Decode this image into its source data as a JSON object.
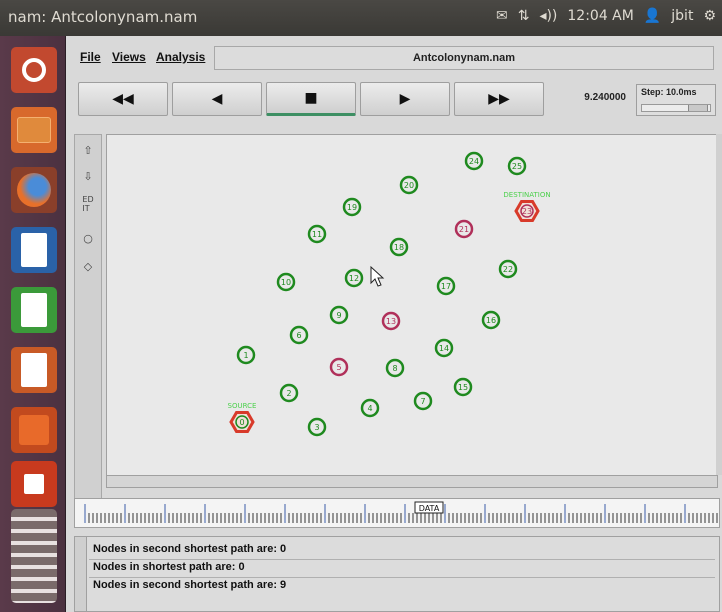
{
  "window": {
    "title": "nam: Antcolonynam.nam"
  },
  "tray": {
    "mail_icon": "mail-icon",
    "network_icon": "network-icon",
    "volume": "◂))",
    "time": "12:04 AM",
    "user": "jbit",
    "settings_icon": "gear-icon"
  },
  "menu": {
    "file": "File",
    "views": "Views",
    "analysis": "Analysis",
    "doc_title": "Antcolonynam.nam"
  },
  "controls": {
    "rewind": "◀◀",
    "back": "◀",
    "stop": "■",
    "play": "▶",
    "forward": "▶▶",
    "time": "9.240000",
    "step": "Step: 10.0ms"
  },
  "network": {
    "nodes": [
      {
        "id": "0",
        "kind": "source"
      },
      {
        "id": "1",
        "kind": "normal"
      },
      {
        "id": "2",
        "kind": "normal"
      },
      {
        "id": "3",
        "kind": "normal"
      },
      {
        "id": "4",
        "kind": "normal"
      },
      {
        "id": "5",
        "kind": "pink"
      },
      {
        "id": "6",
        "kind": "normal"
      },
      {
        "id": "7",
        "kind": "normal"
      },
      {
        "id": "8",
        "kind": "normal"
      },
      {
        "id": "9",
        "kind": "normal"
      },
      {
        "id": "10",
        "kind": "normal"
      },
      {
        "id": "11",
        "kind": "normal"
      },
      {
        "id": "12",
        "kind": "normal"
      },
      {
        "id": "13",
        "kind": "pink"
      },
      {
        "id": "14",
        "kind": "normal"
      },
      {
        "id": "15",
        "kind": "normal"
      },
      {
        "id": "16",
        "kind": "normal"
      },
      {
        "id": "17",
        "kind": "normal"
      },
      {
        "id": "18",
        "kind": "normal"
      },
      {
        "id": "19",
        "kind": "normal"
      },
      {
        "id": "20",
        "kind": "normal"
      },
      {
        "id": "21",
        "kind": "pink"
      },
      {
        "id": "22",
        "kind": "normal"
      },
      {
        "id": "23",
        "kind": "destination"
      },
      {
        "id": "24",
        "kind": "normal"
      },
      {
        "id": "25",
        "kind": "normal"
      }
    ],
    "source_label": "SOURCE",
    "destination_label": "DESTINATION",
    "colors": {
      "normal": "#1f8a1f",
      "pink": "#b0305a",
      "hex": "#d83a2a",
      "label": "#4dd04d"
    }
  },
  "annotations": [
    "Nodes in second shortest path are: 0",
    "Nodes in shortest path are: 0",
    "Nodes in second shortest path are: 9"
  ],
  "timeline": {
    "marker": "DATA"
  }
}
